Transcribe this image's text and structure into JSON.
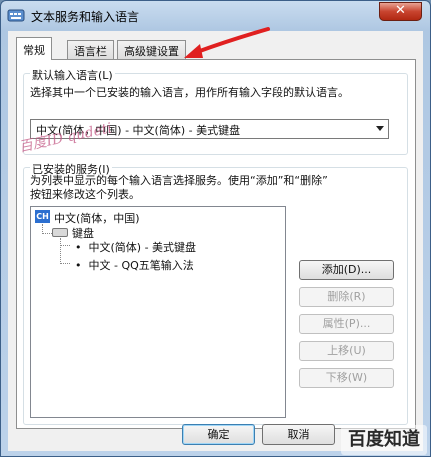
{
  "window": {
    "title": "文本服务和输入语言",
    "close_label": "✕"
  },
  "tabs": [
    {
      "label": "常规",
      "active": true
    },
    {
      "label": "语言栏",
      "active": false
    },
    {
      "label": "高级键设置",
      "active": false
    }
  ],
  "default_language": {
    "group_label": "默认输入语言(L)",
    "description": "选择其中一个已安装的输入语言，用作所有输入字段的默认语言。",
    "selected": "中文(简体，中国) - 中文(简体) - 美式键盘"
  },
  "installed_services": {
    "group_label": "已安装的服务(I)",
    "description_line1": "为列表中显示的每个输入语言选择服务。使用“添加”和“删除”",
    "description_line2": "按钮来修改这个列表。",
    "tree": {
      "language_badge": "CH",
      "language": "中文(简体，中国)",
      "category": "键盘",
      "items": [
        "中文(简体) - 美式键盘",
        "中文 - QQ五笔输入法"
      ]
    },
    "buttons": {
      "add": "添加(D)...",
      "remove": "删除(R)",
      "properties": "属性(P)...",
      "move_up": "上移(U)",
      "move_down": "下移(W)"
    }
  },
  "footer": {
    "ok": "确定",
    "cancel": "取消"
  },
  "overlays": {
    "watermark_text": "百度ID qudeti",
    "logo_text": "百度知道",
    "arrow_color": "#e02020"
  }
}
